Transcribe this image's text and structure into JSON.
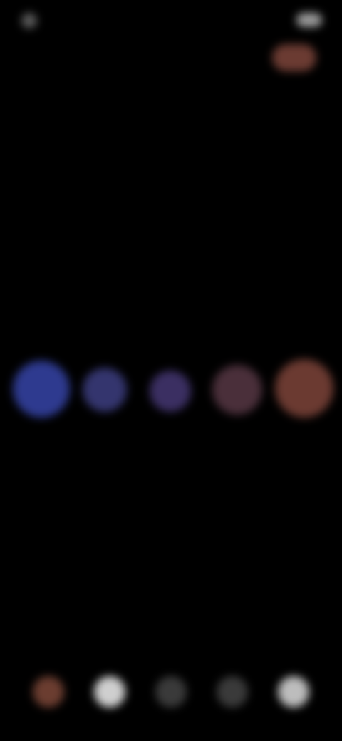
{
  "status": {
    "time": "",
    "battery": ""
  },
  "header": {
    "title": "",
    "subtitle": "",
    "description": ""
  },
  "prompt": {
    "text": ""
  },
  "scale": {
    "left_label": "",
    "right_label": "",
    "options": [
      {
        "name": "option-1",
        "color": "#2e3a8f"
      },
      {
        "name": "option-2",
        "color": "#34356e"
      },
      {
        "name": "option-3",
        "color": "#3b2f62"
      },
      {
        "name": "option-4",
        "color": "#4a2f3a"
      },
      {
        "name": "option-5",
        "color": "#6b3a31"
      }
    ]
  },
  "tabbar": {
    "items": [
      {
        "icon": "profile-icon"
      },
      {
        "icon": "home-icon"
      },
      {
        "icon": "grid-icon"
      },
      {
        "icon": "chart-icon"
      },
      {
        "icon": "settings-icon"
      }
    ]
  }
}
